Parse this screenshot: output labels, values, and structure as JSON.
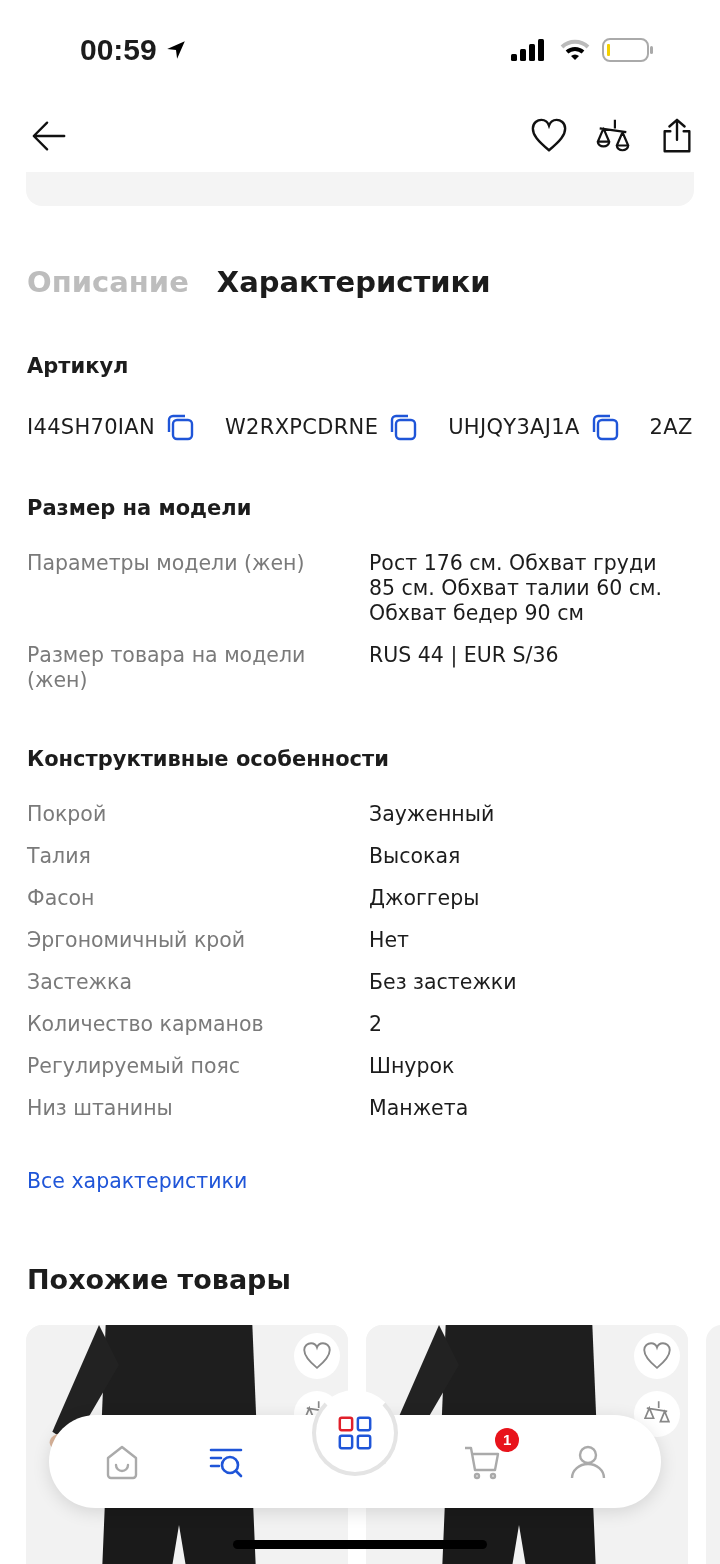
{
  "status_bar": {
    "time": "00:59"
  },
  "tabs": [
    {
      "label": "Описание",
      "selected": false
    },
    {
      "label": "Характеристики",
      "selected": true
    }
  ],
  "article": {
    "title": "Артикул",
    "codes": [
      "I44SH70IAN",
      "W2RXPCDRNE",
      "UHJQY3AJ1A",
      "2AZ"
    ]
  },
  "sections": [
    {
      "title": "Размер на модели",
      "rows": [
        {
          "label": "Параметры модели (жен)",
          "value": "Рост 176 см. Обхват груди 85 см. Обхват талии 60 см. Обхват бедер 90 см"
        },
        {
          "label": "Размер товара на модели (жен)",
          "value": "RUS 44 | EUR S/36"
        }
      ]
    },
    {
      "title": "Конструктивные особенности",
      "rows": [
        {
          "label": "Покрой",
          "value": "Зауженный"
        },
        {
          "label": "Талия",
          "value": "Высокая"
        },
        {
          "label": "Фасон",
          "value": "Джоггеры"
        },
        {
          "label": "Эргономичный крой",
          "value": "Нет"
        },
        {
          "label": "Застежка",
          "value": "Без застежки"
        },
        {
          "label": "Количество карманов",
          "value": "2"
        },
        {
          "label": "Регулируемый пояс",
          "value": "Шнурок"
        },
        {
          "label": "Низ штанины",
          "value": "Манжета"
        }
      ]
    }
  ],
  "all_link": "Все характеристики",
  "similar": {
    "title": "Похожие товары"
  },
  "bottom_nav": [
    {
      "kind": "home",
      "selected": false
    },
    {
      "kind": "search",
      "selected": true
    },
    {
      "kind": "catalog",
      "selected": false
    },
    {
      "kind": "cart",
      "selected": false,
      "badge": "1"
    },
    {
      "kind": "profile",
      "selected": false
    }
  ]
}
